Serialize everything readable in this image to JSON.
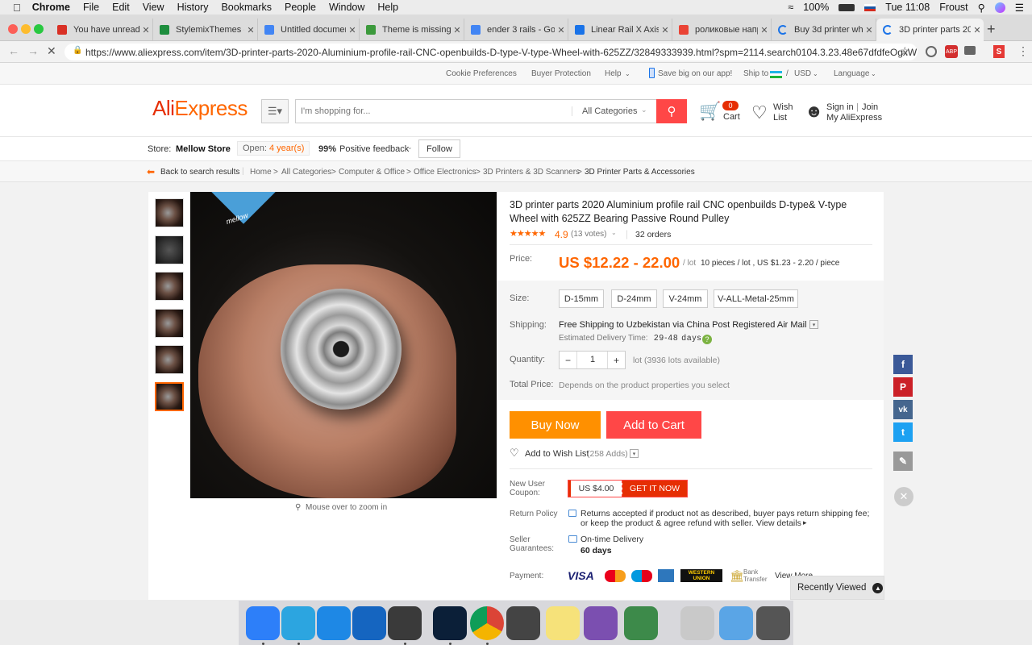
{
  "menubar": {
    "app": "Chrome",
    "items": [
      "File",
      "Edit",
      "View",
      "History",
      "Bookmarks",
      "People",
      "Window",
      "Help"
    ],
    "battery": "100%",
    "clock": "Tue 11:08",
    "user": "Froust"
  },
  "tabs": [
    {
      "title": "You have unread m",
      "icon": "gmail-icon",
      "color": "#d93025"
    },
    {
      "title": "StylemixThemes -",
      "icon": "sheets-icon",
      "color": "#1e8e3e"
    },
    {
      "title": "Untitled document",
      "icon": "docs-icon",
      "color": "#4285f4"
    },
    {
      "title": "Theme is missing",
      "icon": "leaf-icon",
      "color": "#3c9a3c"
    },
    {
      "title": "ender 3 rails - Goo",
      "icon": "google-icon",
      "color": "#4285f4"
    },
    {
      "title": "Linear Rail X Axis f",
      "icon": "site-icon",
      "color": "#1a73e8"
    },
    {
      "title": "роликовые напра",
      "icon": "google-icon",
      "color": "#ea4335"
    },
    {
      "title": "Buy 3d printer whe",
      "icon": "loading-icon",
      "color": "#1a73e8"
    },
    {
      "title": "3D printer parts 20",
      "icon": "loading-icon",
      "color": "#1a73e8"
    }
  ],
  "address": {
    "url": "https://www.aliexpress.com/item/3D-printer-parts-2020-Aluminium-profile-rail-CNC-openbuilds-D-type-V-type-Wheel-with-625ZZ/32849333939.html?spm=2114.search0104.3.23.48e67dfdfeOgxW..."
  },
  "topstrip": {
    "cookie": "Cookie Preferences",
    "protection": "Buyer Protection",
    "help": "Help",
    "app": "Save big on our app!",
    "ship": "Ship to",
    "currency": "USD",
    "language": "Language"
  },
  "header": {
    "logo": "AliExpress",
    "search_placeholder": "I'm shopping for...",
    "categories": "All Categories",
    "cart_count": "0",
    "cart": "Cart",
    "wish1": "Wish",
    "wish2": "List",
    "signin": "Sign in",
    "join": "Join",
    "my": "My AliExpress"
  },
  "store": {
    "label": "Store:",
    "name": "Mellow Store",
    "open": "Open:",
    "years": "4 year(s)",
    "pct": "99%",
    "feedback": "Positive feedback",
    "follow": "Follow"
  },
  "breadcrumb": {
    "back": "Back to search results",
    "items": [
      "Home",
      "All Categories",
      "Computer & Office",
      "Office Electronics",
      "3D Printers & 3D Scanners",
      "3D Printer Parts & Accessories"
    ]
  },
  "product": {
    "brand": "mellow",
    "title1": "3D printer parts 2020 Aluminium profile rail CNC openbuilds D-type& V-type",
    "title2": "Wheel with 625ZZ Bearing Passive Round Pulley",
    "rating": "4.9",
    "votes": "(13 votes)",
    "orders": "32 orders",
    "price_label": "Price:",
    "price": "US $12.22 - 22.00",
    "lot": "/ lot",
    "lot_detail": "10 pieces / lot , US $1.23 - 2.20 / piece",
    "size_label": "Size:",
    "sizes": [
      "D-15mm",
      "D-24mm",
      "V-24mm",
      "V-ALL-Metal-25mm"
    ],
    "shipping_label": "Shipping:",
    "shipping": "Free Shipping to Uzbekistan via China Post Registered Air Mail",
    "delivery_label": "Estimated Delivery Time:",
    "delivery_days": "29-48 days",
    "qty_label": "Quantity:",
    "qty": "1",
    "qty_avail": "lot (3936 lots available)",
    "total_label": "Total Price:",
    "total": "Depends on the product properties you select",
    "buy": "Buy Now",
    "add": "Add to Cart",
    "wish": "Add to Wish List",
    "wish_count": "(258 Adds)",
    "coupon_label1": "New User",
    "coupon_label2": "Coupon:",
    "coupon_value": "US $4.00",
    "coupon_btn": "GET IT NOW",
    "return_label": "Return Policy",
    "return1": "Returns accepted if product not as described, buyer pays return shipping fee;",
    "return2": "or keep the product & agree refund with seller.",
    "view_details": "View details",
    "seller_label1": "Seller",
    "seller_label2": "Guarantees:",
    "ontime": "On-time Delivery",
    "days": "60 days",
    "payment_label": "Payment:",
    "payments": [
      "VISA",
      "MasterCard",
      "Maestro",
      "AmEx",
      "WESTERN UNION",
      "Bank Transfer"
    ],
    "view_more": "View More",
    "zoom": "Mouse over to zoom in"
  },
  "recently": "Recently Viewed",
  "dock": [
    {
      "name": "finder",
      "color": "#2d7ff9"
    },
    {
      "name": "telegram",
      "color": "#2ca5e0"
    },
    {
      "name": "codeshot",
      "color": "#1e88e5"
    },
    {
      "name": "mercury",
      "color": "#1565c0"
    },
    {
      "name": "quicktime",
      "color": "#3a3a3a"
    },
    {
      "name": "photoshop",
      "color": "#0b1f38"
    },
    {
      "name": "chrome",
      "color": "#e8e8e8"
    },
    {
      "name": "final-cut",
      "color": "#444"
    },
    {
      "name": "notes",
      "color": "#f6e27a"
    },
    {
      "name": "quill",
      "color": "#7b4fb0"
    },
    {
      "name": "palms",
      "color": "#3d8a4a"
    },
    {
      "name": "preview",
      "color": "#c9c9c9"
    },
    {
      "name": "folder",
      "color": "#5aa5e6"
    },
    {
      "name": "trash",
      "color": "#555"
    }
  ],
  "colors": {
    "accent": "#ff4747",
    "orange": "#f60",
    "buy": "#ff9000",
    "cart": "#ff4747"
  }
}
